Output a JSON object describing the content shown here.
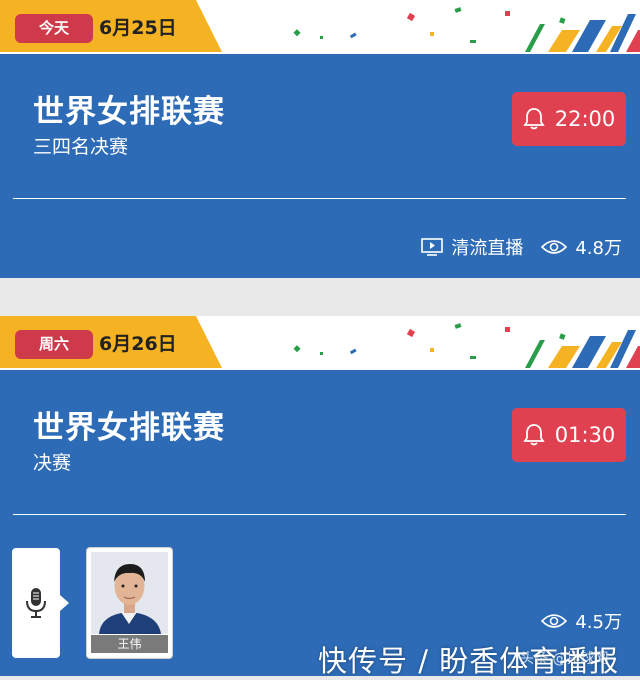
{
  "cards": [
    {
      "day_badge": "今天",
      "date": "6月25日",
      "title": "世界女排联赛",
      "subtitle": "三四名决赛",
      "remind_time": "22:00",
      "stream_icon": "play-screen-icon",
      "stream_label": "清流直播",
      "views_icon": "eye-icon",
      "views": "4.8万"
    },
    {
      "day_badge": "周六",
      "date": "6月26日",
      "title": "世界女排联赛",
      "subtitle": "决赛",
      "remind_time": "01:30",
      "commentator_icon": "microphone-icon",
      "commentator_name": "王伟",
      "views_icon": "eye-icon",
      "views": "4.5万"
    }
  ],
  "colors": {
    "accent_tab": "#f5b324",
    "badge_red": "#cf3a4a",
    "panel_blue": "#2d6bb6",
    "remind_red": "#e04150"
  },
  "watermark": {
    "main": "快传号 / 盼香体育播报",
    "small": "头条 @排球网"
  }
}
